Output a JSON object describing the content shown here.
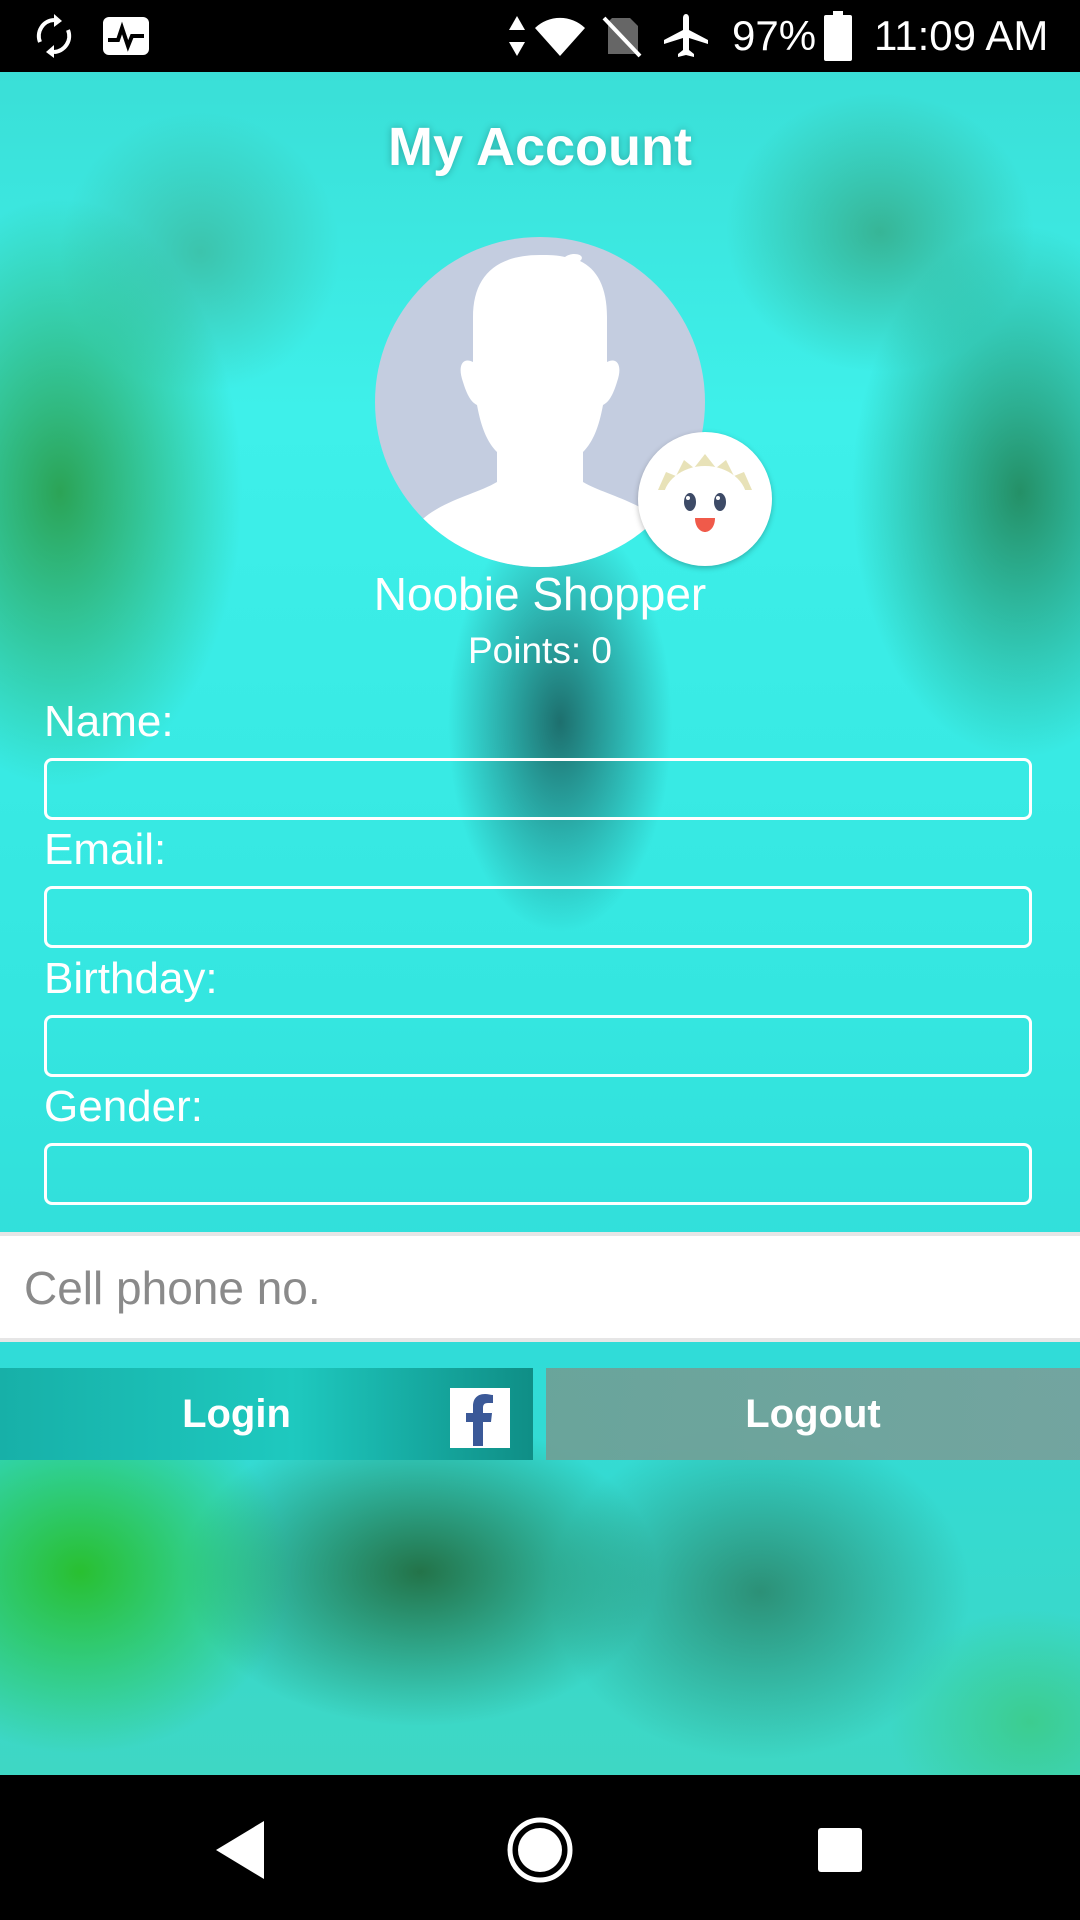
{
  "status_bar": {
    "icons": [
      "sync-icon",
      "activity-icon",
      "data-arrows-icon",
      "wifi-icon",
      "no-sim-icon",
      "airplane-mode-icon",
      "battery-icon"
    ],
    "battery": "97%",
    "time": "11:09 AM"
  },
  "header": {
    "title": "My Account"
  },
  "profile": {
    "avatar_icon": "person-silhouette-icon",
    "badge_icon": "mascot-icon",
    "name": "Noobie Shopper",
    "points_label": "Points:",
    "points_value": "0"
  },
  "form": {
    "name_label": "Name:",
    "name_value": "",
    "email_label": "Email:",
    "email_value": "",
    "birthday_label": "Birthday:",
    "birthday_value": "",
    "gender_label": "Gender:",
    "gender_value": "",
    "phone_placeholder": "Cell phone no.",
    "phone_value": ""
  },
  "actions": {
    "login_label": "Login",
    "facebook_icon": "facebook-icon",
    "logout_label": "Logout"
  },
  "nav_bar": {
    "icons": [
      "back-icon",
      "home-icon",
      "recents-icon"
    ]
  },
  "colors": {
    "accent": "#1ec9bf",
    "background": "#3ef0ea",
    "facebook": "#3b5998"
  }
}
